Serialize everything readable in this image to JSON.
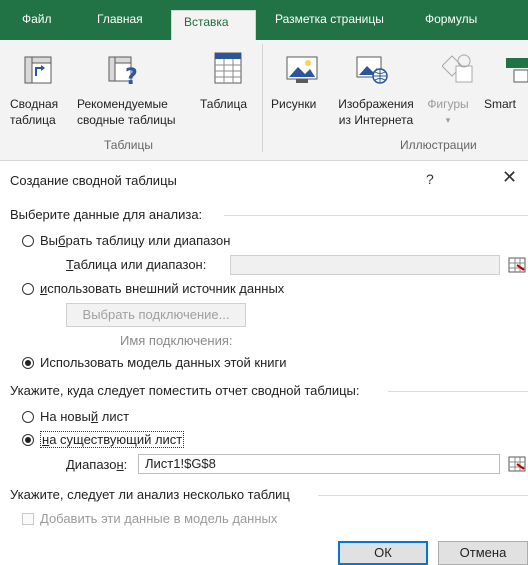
{
  "ribbon": {
    "tabs": [
      "Файл",
      "Главная",
      "Вставка",
      "Разметка страницы",
      "Формулы"
    ],
    "active_tab": "Вставка",
    "groups": {
      "tables": {
        "label": "Таблицы",
        "commands": [
          {
            "line1": "Сводная",
            "line2": "таблица",
            "icon": "pivot-table-icon"
          },
          {
            "line1": "Рекомендуемые",
            "line2": "сводные таблицы",
            "icon": "recommended-pivot-icon"
          },
          {
            "line1": "Таблица",
            "line2": "",
            "icon": "table-icon"
          }
        ]
      },
      "illustrations": {
        "label": "Иллюстрации",
        "commands": [
          {
            "line1": "Рисунки",
            "line2": "",
            "icon": "pictures-icon"
          },
          {
            "line1": "Изображения",
            "line2": "из Интернета",
            "icon": "online-pictures-icon"
          },
          {
            "line1": "Фигуры",
            "line2": "",
            "icon": "shapes-icon"
          },
          {
            "line1": "Smart",
            "line2": "",
            "icon": "smartart-icon"
          }
        ]
      }
    }
  },
  "dialog": {
    "title": "Создание сводной таблицы",
    "help": "?",
    "close": "✕",
    "section_choose": "Выберите данные для анализа:",
    "opt_range": {
      "pre": "Вы",
      "u": "б",
      "post": "рать таблицу или диапазон"
    },
    "range_label": {
      "u": "Т",
      "post": "аблица или диапазон:"
    },
    "range_value": "",
    "opt_external": {
      "u": "и",
      "post": "спользовать внешний источник данных"
    },
    "choose_connection": "Выбрать подключение...",
    "connection_name_label": "Имя подключения:",
    "opt_model": "Использовать модель данных этой книги",
    "section_place": "Укажите, куда следует поместить отчет сводной таблицы:",
    "opt_new_sheet": {
      "pre": "На новы",
      "u": "й",
      "post": " лист"
    },
    "opt_existing_sheet": {
      "u": "н",
      "post": "а существующий лист"
    },
    "location_label": {
      "pre": "Диапазо",
      "u": "н",
      "post": ":"
    },
    "location_value": "Лист1!$G$8",
    "section_multi": "Укажите, следует ли анализ несколько таблиц",
    "add_to_model": "Добавить эти данные в модель данных",
    "ok": "ОК",
    "cancel": "Отмена"
  },
  "colors": {
    "accent": "#217346",
    "focus": "#0078d7"
  }
}
